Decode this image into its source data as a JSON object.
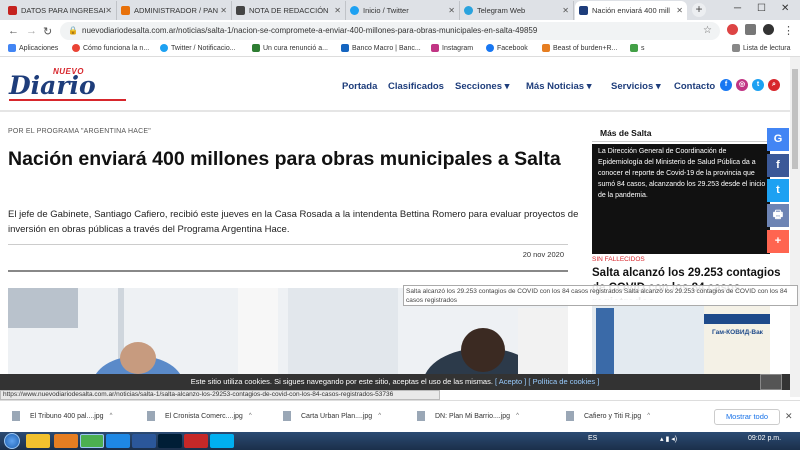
{
  "browser": {
    "tabs": [
      {
        "title": "DATOS PARA INGRESAR",
        "color": "#c5221f"
      },
      {
        "title": "ADMINISTRADOR / PAN",
        "color": "#e8710a"
      },
      {
        "title": "NOTA DE REDACCIÓN",
        "color": "#444444"
      },
      {
        "title": "Inicio / Twitter",
        "color": "#1da1f2"
      },
      {
        "title": "Telegram Web",
        "color": "#2aa3de"
      },
      {
        "title": "Nación enviará 400 mill",
        "color": "#1e3d7b"
      }
    ],
    "url": "nuevodiariodesalta.com.ar/noticias/salta-1/nacion-se-compromete-a-enviar-400-millones-para-obras-municipales-en-salta-49859",
    "bookmarks": [
      "Aplicaciones",
      "Cómo funciona la n...",
      "Twitter / Notificacio...",
      "Un cura renunció a...",
      "Banco Macro | Banc...",
      "Instagram",
      "Facebook",
      "Beast of burden+R...",
      "s"
    ],
    "reading_list": "Lista de lectura"
  },
  "site": {
    "logo_small": "NUEVO",
    "logo_main": "Diario",
    "nav": [
      "Portada",
      "Clasificados",
      "Secciones ▾",
      "Más Noticias ▾",
      "Servicios ▾",
      "Contacto"
    ]
  },
  "article": {
    "kicker": "POR EL PROGRAMA \"ARGENTINA HACE\"",
    "headline": "Nación enviará 400 millones para obras municipales a Salta",
    "lead": "El jefe de Gabinete, Santiago Cafiero, recibió este jueves en la Casa Rosada a la intendenta Bettina Romero para evaluar proyectos de inversión en obras públicas a través del Programa Argentina Hace.",
    "date": "20 nov 2020"
  },
  "sidebar": {
    "title": "Más de Salta",
    "img_text": "La Dirección General de Coordinación de Epidemiología del Ministerio de Salud Pública da a conocer el reporte de Covid-19 de la provincia que sumó 84 casos, alcanzando los 29.253 desde el inicio de la pandemia.",
    "category": "SIN FALLECIDOS",
    "headline": "Salta alcanzó los 29.253 contagios de COVID con los 84 casos registrados",
    "vaccine_label": "Гам-КОВИД-Вак"
  },
  "tooltip": "Salta alcanzó los 29.253 contagios de COVID con los 84 casos registrados Salta alcanzó los 29.253 contagios de COVID con los 84 casos registrados",
  "share": [
    "G",
    "f",
    "t",
    "🖶",
    "+"
  ],
  "cookie": {
    "text": "Este sitio utiliza cookies. Si sigues navegando por este sitio, aceptas el uso de las mismas.",
    "accept": "[ Acepto ]",
    "policy": "[ Política de cookies ]"
  },
  "status_url": "https://www.nuevodiariodesalta.com.ar/noticias/salta-1/salta-alcanzo-los-29253-contagios-de-covid-con-los-84-casos-registrados-53736",
  "downloads": {
    "items": [
      "El Tribuno 400 pal....jpg",
      "El Cronista Comerc....jpg",
      "Carta Urban Plan....jpg",
      "DN: Plan Mi Barrio....jpg",
      "Cafiero y Titi R.jpg"
    ],
    "show_all": "Mostrar todo"
  },
  "taskbar": {
    "lang": "ES",
    "time": "09:02 p.m."
  }
}
